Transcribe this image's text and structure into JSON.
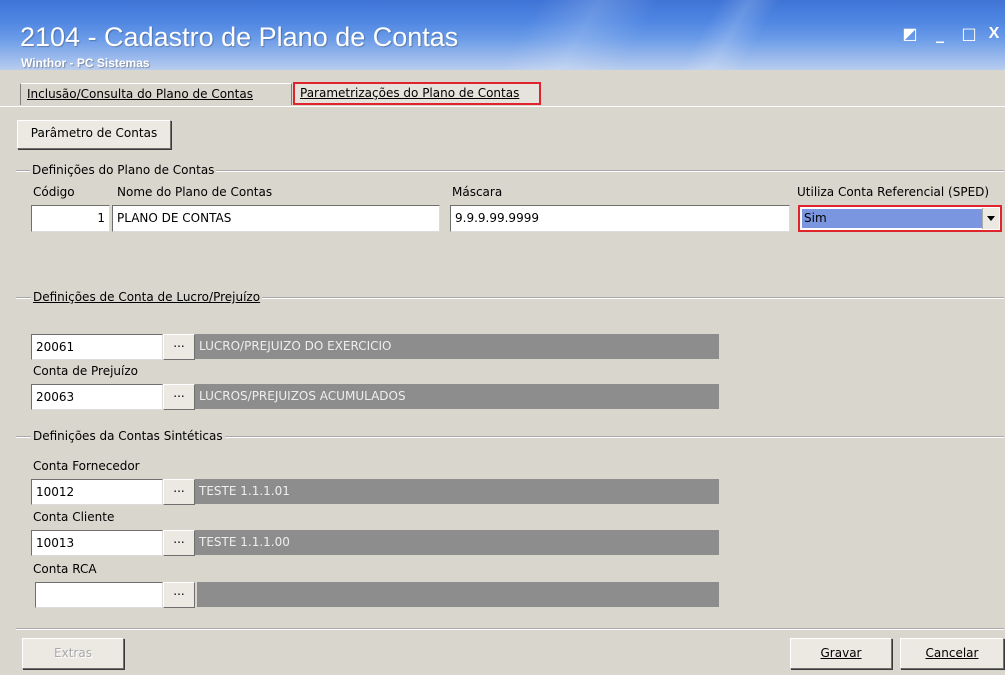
{
  "window": {
    "title": "2104 - Cadastro de Plano de Contas",
    "subtitle": "Winthor - PC Sistemas",
    "controls": {
      "restore": "◩",
      "minimize": "_",
      "maximize": "□",
      "close": "X"
    }
  },
  "tabs": [
    {
      "label": "Inclusão/Consulta do Plano de Contas",
      "active": false
    },
    {
      "label": "Parametrizações do Plano de Contas",
      "active": true,
      "highlighted": true
    }
  ],
  "toolbar": {
    "parametro_button": "Parâmetro de Contas"
  },
  "definicoes_plano": {
    "legend": "Definições do Plano de Contas",
    "codigo_label": "Código",
    "codigo_value": "1",
    "nome_label": "Nome do Plano de Contas",
    "nome_value": "PLANO DE CONTAS",
    "mascara_label": "Máscara",
    "mascara_value": "9.9.9.99.9999",
    "sped_label": "Utiliza Conta Referencial (SPED)",
    "sped_value": "Sim"
  },
  "lucro_prejuizo": {
    "legend": "Definições de Conta de Lucro/Prejuízo",
    "lucro_code": "20061",
    "lucro_desc": "LUCRO/PREJUIZO DO EXERCICIO",
    "prejuizo_label": "Conta de Prejuízo",
    "prejuizo_code": "20063",
    "prejuizo_desc": "LUCROS/PREJUIZOS ACUMULADOS"
  },
  "sinteticas": {
    "legend": "Definições da Contas Sintéticas",
    "fornecedor_label": "Conta Fornecedor",
    "fornecedor_code": "10012",
    "fornecedor_desc": "TESTE 1.1.1.01",
    "cliente_label": "Conta Cliente",
    "cliente_code": "10013",
    "cliente_desc": "TESTE 1.1.1.00",
    "rca_label": "Conta RCA",
    "rca_code": "",
    "rca_desc": ""
  },
  "lookup_label": "...",
  "footer": {
    "extras": "Extras",
    "gravar": "Gravar",
    "cancelar": "Cancelar"
  },
  "colors": {
    "highlight_red": "#e0242d",
    "selection_blue": "#0a246a",
    "titlebar_blue": "#3f74d6"
  }
}
